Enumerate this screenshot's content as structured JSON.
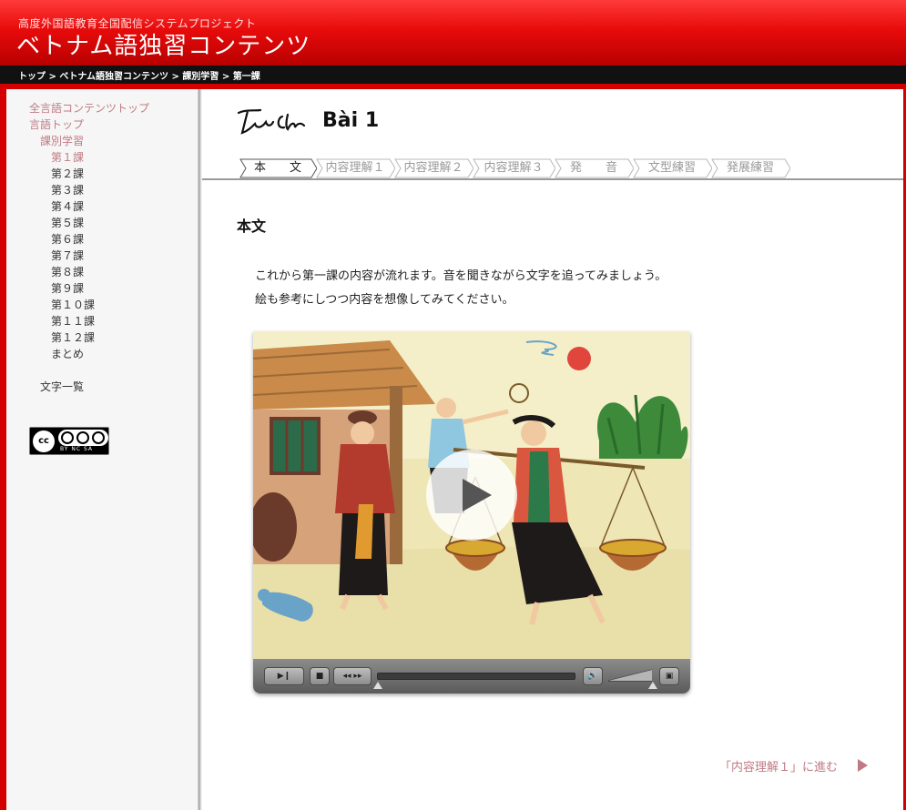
{
  "header": {
    "subtitle": "高度外国語教育全国配信システムプロジェクト",
    "title": "ベトナム語独習コンテンツ",
    "breadcrumb": "トップ > ベトナム語独習コンテンツ > 課別学習 > 第一課"
  },
  "sidebar": {
    "all_languages_top": "全言語コンテンツトップ",
    "language_top": "言語トップ",
    "lesson_study": "課別学習",
    "lessons": [
      "第１課",
      "第２課",
      "第３課",
      "第４課",
      "第５課",
      "第６課",
      "第７課",
      "第８課",
      "第９課",
      "第１０課",
      "第１１課",
      "第１２課",
      "まとめ"
    ],
    "char_list": "文字一覧",
    "license": {
      "badge": "cc",
      "label": "BY  NC  SA"
    }
  },
  "lesson": {
    "logo_text": "Tấm Cám",
    "title": "Bài 1"
  },
  "tabs": [
    {
      "label": "本　　文",
      "active": true
    },
    {
      "label": "内容理解１",
      "active": false
    },
    {
      "label": "内容理解２",
      "active": false
    },
    {
      "label": "内容理解３",
      "active": false
    },
    {
      "label": "発　　音",
      "active": false
    },
    {
      "label": "文型練習",
      "active": false
    },
    {
      "label": "発展練習",
      "active": false
    }
  ],
  "main": {
    "heading": "本文",
    "paragraph": [
      "これから第一課の内容が流れます。音を聞きながら文字を追ってみましょう。",
      "絵も参考にしつつ内容を想像してみてください。"
    ],
    "next_link": "「内容理解１」に進む"
  },
  "video": {
    "progress": 0,
    "volume": 1.0
  },
  "colors": {
    "brand_red": "#e80b0b",
    "link_pink": "#c07a84",
    "tab_inactive": "#9a9a9a"
  }
}
